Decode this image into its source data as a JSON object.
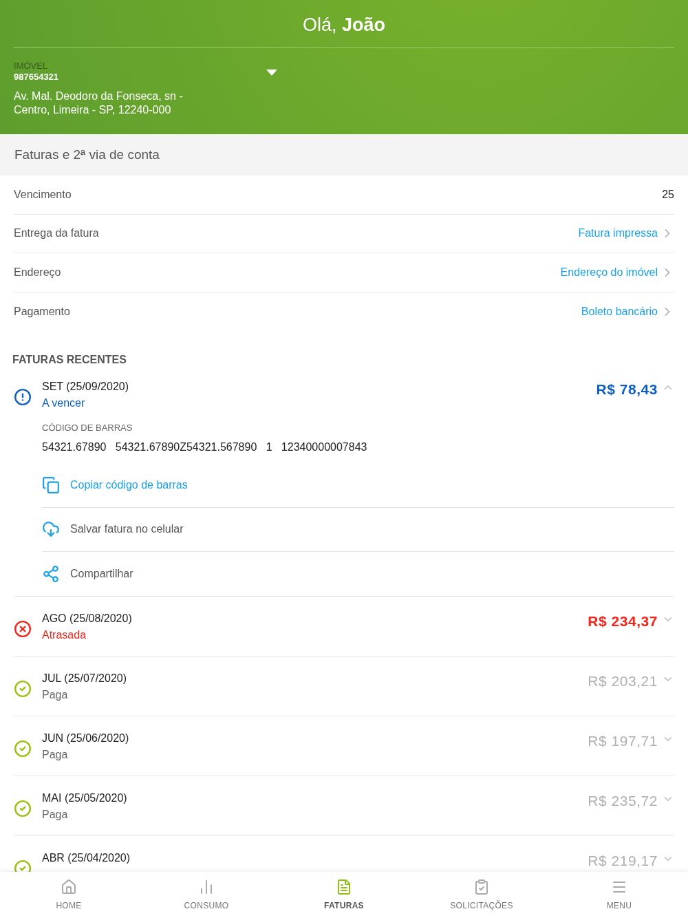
{
  "header": {
    "greeting": "Olá,",
    "name": "João",
    "property_label": "IMÓVEL",
    "property_number": "987654321",
    "address": "Av. Mal. Deodoro da Fonseca, sn  - Centro, Limeira - SP, 12240-000"
  },
  "section_title": "Faturas e 2ª via de conta",
  "settings": [
    {
      "kind": "value",
      "label": "Vencimento",
      "value": "25"
    },
    {
      "kind": "link",
      "label": "Entrega da fatura",
      "value": "Fatura impressa"
    },
    {
      "kind": "link",
      "label": "Endereço",
      "value": "Endereço do imóvel"
    },
    {
      "kind": "link",
      "label": "Pagamento",
      "value": "Boleto bancário"
    }
  ],
  "recent_title": "FATURAS RECENTES",
  "invoices": [
    {
      "kind": "due",
      "title": "SET (25/09/2020)",
      "status": "A vencer",
      "amount": "R$ 78,43",
      "expanded": true,
      "barcode_label": "CÓDIGO DE BARRAS",
      "barcode": "54321.67890   54321.67890Z54321.567890   1   12340000007843",
      "actions": [
        {
          "kind": "copy",
          "label": "Copiar código de barras"
        },
        {
          "kind": "save",
          "label": "Salvar fatura no celular"
        },
        {
          "kind": "share",
          "label": "Compartilhar"
        }
      ]
    },
    {
      "kind": "overdue",
      "title": "AGO (25/08/2020)",
      "status": "Atrasada",
      "amount": "R$ 234,37",
      "expanded": false
    },
    {
      "kind": "paid",
      "title": "JUL (25/07/2020)",
      "status": "Paga",
      "amount": "R$ 203,21",
      "expanded": false
    },
    {
      "kind": "paid",
      "title": "JUN (25/06/2020)",
      "status": "Paga",
      "amount": "R$ 197,71",
      "expanded": false
    },
    {
      "kind": "paid",
      "title": "MAI (25/05/2020)",
      "status": "Paga",
      "amount": "R$ 235,72",
      "expanded": false
    },
    {
      "kind": "paid",
      "title": "ABR (25/04/2020)",
      "amount": "R$ 219,17",
      "expanded": false
    }
  ],
  "nav": [
    {
      "kind": "home",
      "label": "HOME",
      "selected": false
    },
    {
      "kind": "chart",
      "label": "CONSUMO",
      "selected": false
    },
    {
      "kind": "bill",
      "label": "FATURAS",
      "selected": true
    },
    {
      "kind": "requests",
      "label": "SOLICITAÇÕES",
      "selected": false
    },
    {
      "kind": "menu",
      "label": "MENU",
      "selected": false
    }
  ]
}
